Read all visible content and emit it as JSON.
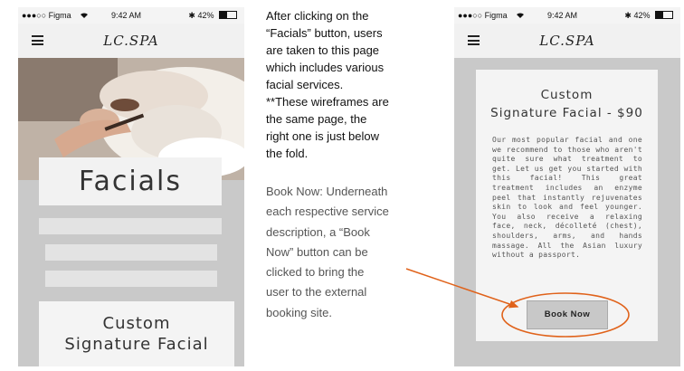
{
  "status_bar": {
    "carrier": "●●●○○ Figma",
    "wifi_icon": "wifi-icon",
    "time": "9:42 AM",
    "bluetooth": "✱",
    "battery_percent": "42%",
    "battery_level": 0.42
  },
  "nav": {
    "brand": "LC.SPA",
    "menu_icon": "hamburger-menu-icon"
  },
  "left_screen": {
    "hero_title": "Facials",
    "placeholder_bars": 3,
    "card_title_lines": [
      "Custom",
      "Signature Facial"
    ]
  },
  "right_screen": {
    "card_title_lines": [
      "Custom",
      "Signature Facial - $90"
    ],
    "description": "Our most popular facial and one we recommend to those who aren't quite sure what treatment to get. Let us get you started with this facial! This great treatment includes an enzyme peel that instantly rejuvenates skin to look and feel younger. You also receive a relaxing face, neck, décolleté (chest), shoulders, arms, and hands massage. All the Asian luxury without a passport.",
    "book_button": "Book Now"
  },
  "annotations": {
    "facials_note_lines": [
      "After clicking on the",
      "“Facials” button, users",
      "are taken to this page",
      "which includes various",
      "facial services.",
      "**These wireframes are",
      "the same page, the",
      "right one is just below",
      "the fold."
    ],
    "book_note_lines": [
      "Book Now: Underneath",
      "each respective service",
      "description, a “Book",
      "Now” button can be",
      "clicked to bring the",
      "user to the external",
      "booking site."
    ]
  },
  "colors": {
    "phone_bg": "#c9c9c9",
    "card_bg": "#f4f4f4",
    "highlight": "#e0621a"
  }
}
